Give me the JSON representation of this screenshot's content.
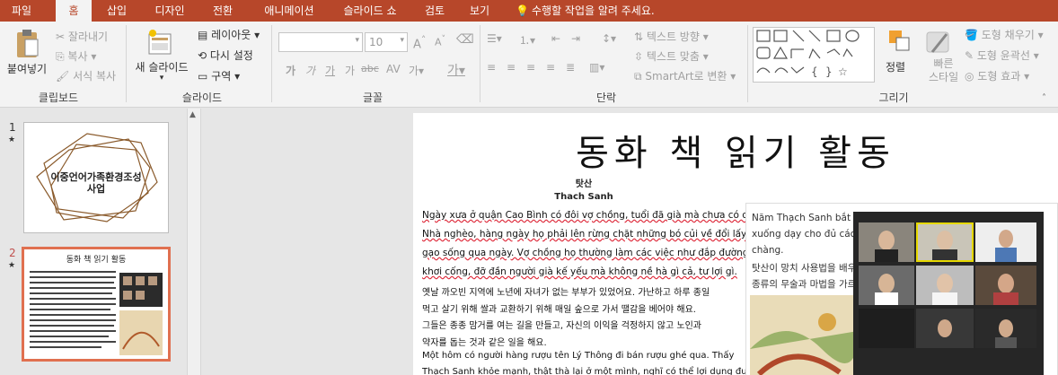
{
  "tabs": [
    "파일",
    "홈",
    "삽입",
    "디자인",
    "전환",
    "애니메이션",
    "슬라이드 쇼",
    "검토",
    "보기"
  ],
  "tell_me": "수행할 작업을 알려 주세요.",
  "clipboard": {
    "paste": "붙여넣기",
    "cut": "잘라내기",
    "copy": "복사",
    "format_painter": "서식 복사",
    "label": "클립보드"
  },
  "slides_group": {
    "new_slide": "새 슬라이드",
    "layout": "레이아웃",
    "reset": "다시 설정",
    "section": "구역",
    "label": "슬라이드"
  },
  "font_group": {
    "font_size": "10",
    "label": "글꼴",
    "glyphs": [
      "가",
      "가",
      "가",
      "가",
      "abc",
      "가",
      "가"
    ]
  },
  "paragraph_group": {
    "text_direction": "텍스트 방향",
    "align_text": "텍스트 맞춤",
    "smartart": "SmartArt로 변환",
    "label": "단락"
  },
  "drawing_group": {
    "arrange": "정렬",
    "quick_styles": "빠른\n스타일",
    "shape_fill": "도형 채우기",
    "shape_outline": "도형 윤곽선",
    "shape_effects": "도형 효과",
    "label": "그리기"
  },
  "thumbnails": [
    {
      "number": "1",
      "title": "이중언어가족환경조성\n사업"
    },
    {
      "number": "2",
      "title": "동화 책 읽기 활동"
    }
  ],
  "slide": {
    "title": "동화 책 읽기 활동",
    "story_title_ko": "탓산",
    "story_title_vi": "Thach Sanh",
    "lines": [
      "Ngày xưa ở quận Cao Bình có đôi vợ chồng, tuổi đã già mà chưa có con.",
      "Nhà nghèo, hàng ngày họ phải lên rừng chặt những bó củi về đổi lấy",
      "gạo sống qua ngày. Vợ chồng họ thường làm các việc như đắp đường",
      "khơi cống, đỡ đần người già kế yếu mà không nề hà gì cả, tư lợi gì.",
      "옛날 까오빈 지역에 노년에 자녀가 없는 부부가 있었어요. 가난하고 하루 종일",
      "먹고 살기 위해 쌀과 교환하기 위해 매일 숲으로 가서 땔감을 베어야 해요.",
      "그들은 종종 맘거를 여는 길을 만들고, 자신의 이익을 걱정하지 않고 노인과",
      "약자를 돕는 것과 같은 일을 해요.",
      "Một hôm có người hàng rượu tên Lý Thông đi bán rượu ghé qua. Thấy",
      "Thạch Sanh khỏe mạnh, thật thà lại ở một mình, nghĩ có thể lợi dụng được,"
    ],
    "right_lines": [
      "Năm Thạch Sanh bắt đầ",
      "xuống dạy cho đủ các m",
      "chàng.",
      "탓산이 망치 사용법을 배우",
      "종류의 무술과 마법을 가르"
    ]
  }
}
